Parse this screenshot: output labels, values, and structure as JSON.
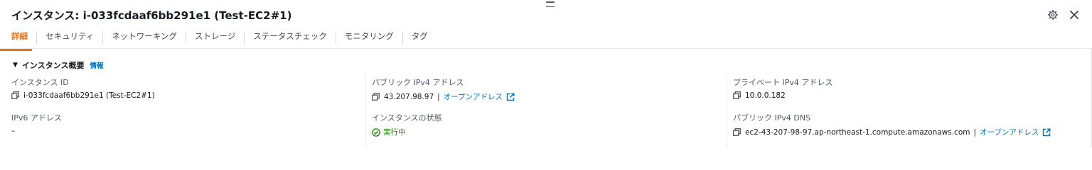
{
  "header": {
    "title": "インスタンス: i-033fcdaaf6bb291e1 (Test-EC2#1)"
  },
  "tabs": [
    {
      "label": "詳細",
      "active": true
    },
    {
      "label": "セキュリティ",
      "active": false
    },
    {
      "label": "ネットワーキング",
      "active": false
    },
    {
      "label": "ストレージ",
      "active": false
    },
    {
      "label": "ステータスチェック",
      "active": false
    },
    {
      "label": "モニタリング",
      "active": false
    },
    {
      "label": "タグ",
      "active": false
    }
  ],
  "section": {
    "title": "インスタンス概要",
    "info_link": "情報"
  },
  "fields": {
    "instance_id": {
      "label": "インスタンス ID",
      "value": "i-033fcdaaf6bb291e1 (Test-EC2#1)"
    },
    "ipv6": {
      "label": "IPv6 アドレス",
      "value": "–"
    },
    "public_ipv4": {
      "label": "パブリック IPv4 アドレス",
      "value": "43.207.98.97",
      "link": "オープンアドレス"
    },
    "instance_state": {
      "label": "インスタンスの状態",
      "value": "実行中"
    },
    "private_ipv4": {
      "label": "プライベート IPv4 アドレス",
      "value": "10.0.0.182"
    },
    "public_dns": {
      "label": "パブリック IPv4 DNS",
      "value": "ec2-43-207-98-97.ap-northeast-1.compute.amazonaws.com",
      "link": "オープンアドレス"
    }
  },
  "separator": "|",
  "colors": {
    "accent": "#ec7211",
    "link": "#0073bb",
    "success": "#1d8102"
  },
  "icons": [
    "drag-handle-icon",
    "gear-icon",
    "close-icon",
    "caret-down-icon",
    "copy-icon",
    "external-link-icon",
    "check-circle-icon"
  ]
}
